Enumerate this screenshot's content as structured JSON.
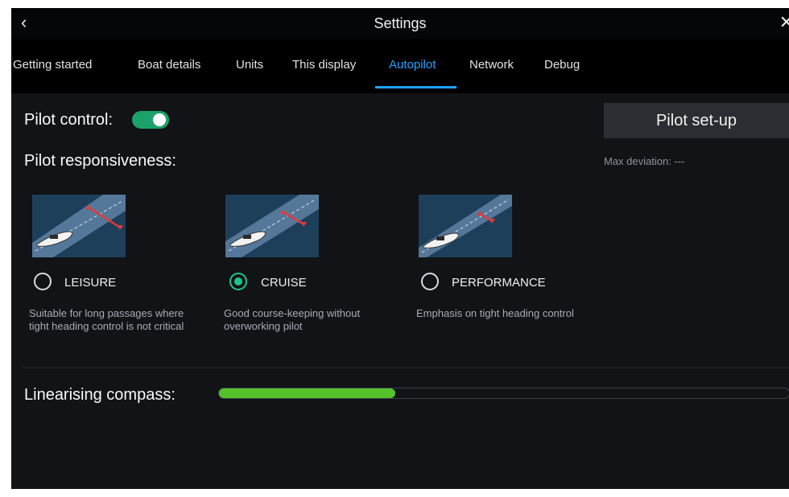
{
  "header": {
    "back_icon": "chevron-left-icon",
    "title": "Settings",
    "close_icon": "close-icon"
  },
  "tabs": [
    {
      "label": "Getting started",
      "active": false
    },
    {
      "label": "Boat details",
      "active": false
    },
    {
      "label": "Units",
      "active": false
    },
    {
      "label": "This display",
      "active": false
    },
    {
      "label": "Autopilot",
      "active": true
    },
    {
      "label": "Network",
      "active": false
    },
    {
      "label": "Debug",
      "active": false
    }
  ],
  "pilot_control": {
    "label": "Pilot control:",
    "enabled": true
  },
  "pilot_setup": {
    "button_label": "Pilot set-up",
    "max_deviation": "Max deviation: ---"
  },
  "responsiveness": {
    "label": "Pilot responsiveness:",
    "selected": "CRUISE",
    "options": [
      {
        "label": "LEISURE",
        "description": "Suitable for long passages where tight heading control is not critical",
        "icon": "leisure-boat-icon"
      },
      {
        "label": "CRUISE",
        "description": "Good course-keeping without overworking pilot",
        "icon": "cruise-boat-icon"
      },
      {
        "label": "PERFORMANCE",
        "description": "Emphasis on tight heading control",
        "icon": "performance-boat-icon"
      }
    ]
  },
  "linearising": {
    "label": "Linearising compass:",
    "progress_percent": 31
  },
  "colors": {
    "accent": "#1fa2ff",
    "toggle_on": "#1aa26a",
    "radio_selected": "#1ec58b",
    "progress_fill": "#56c22b",
    "corridor_arrow": "#e03b3b"
  }
}
